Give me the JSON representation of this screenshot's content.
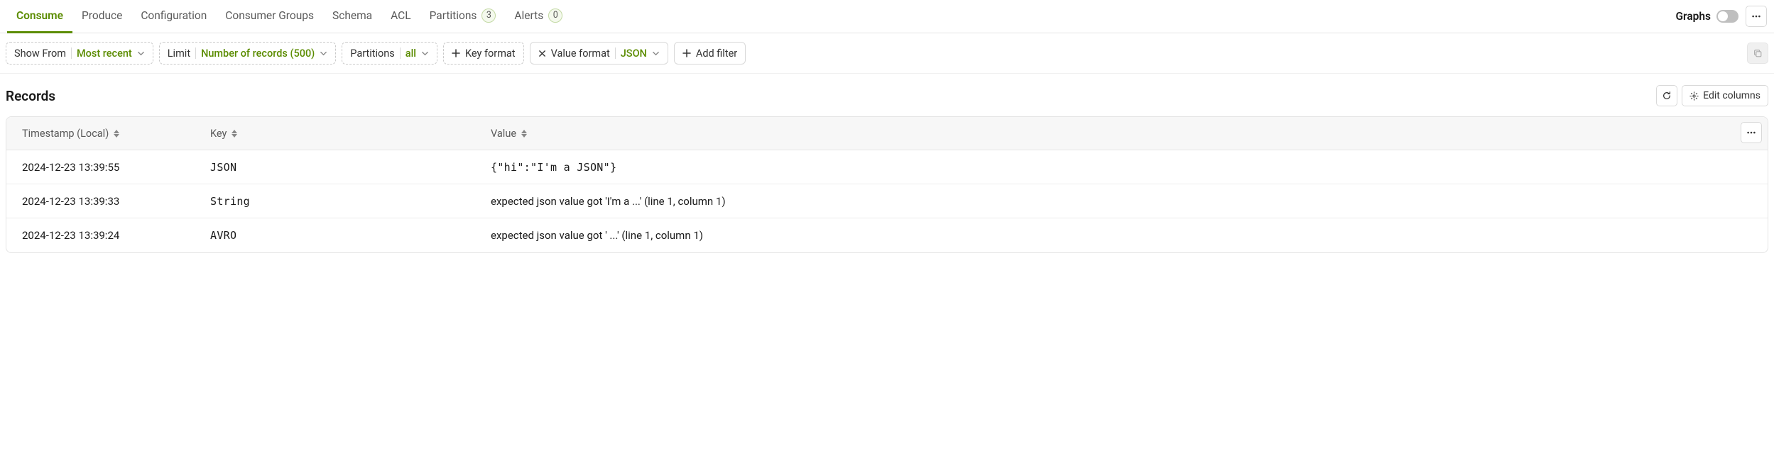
{
  "tabs": {
    "consume": "Consume",
    "produce": "Produce",
    "configuration": "Configuration",
    "consumer_groups": "Consumer Groups",
    "schema": "Schema",
    "acl": "ACL",
    "partitions": "Partitions",
    "partitions_count": "3",
    "alerts": "Alerts",
    "alerts_count": "0"
  },
  "header": {
    "graphs_label": "Graphs"
  },
  "filters": {
    "show_from": {
      "label": "Show From",
      "value": "Most recent"
    },
    "limit": {
      "label": "Limit",
      "value": "Number of records (500)"
    },
    "partitions": {
      "label": "Partitions",
      "value": "all"
    },
    "key_format": {
      "label": "Key format"
    },
    "value_format": {
      "label": "Value format",
      "value": "JSON"
    },
    "add_filter": {
      "label": "Add filter"
    }
  },
  "records": {
    "title": "Records",
    "edit_columns": "Edit columns",
    "columns": {
      "timestamp": "Timestamp (Local)",
      "key": "Key",
      "value": "Value"
    },
    "rows": [
      {
        "ts": "2024-12-23 13:39:55",
        "key": "JSON",
        "value": "{\"hi\":\"I'm a JSON\"}",
        "mono": true
      },
      {
        "ts": "2024-12-23 13:39:33",
        "key": "String",
        "value": "expected json value got 'I'm a ...' (line 1, column 1)",
        "mono": false
      },
      {
        "ts": "2024-12-23 13:39:24",
        "key": "AVRO",
        "value": "expected json value got '   ...' (line 1, column 1)",
        "mono": false
      }
    ]
  }
}
